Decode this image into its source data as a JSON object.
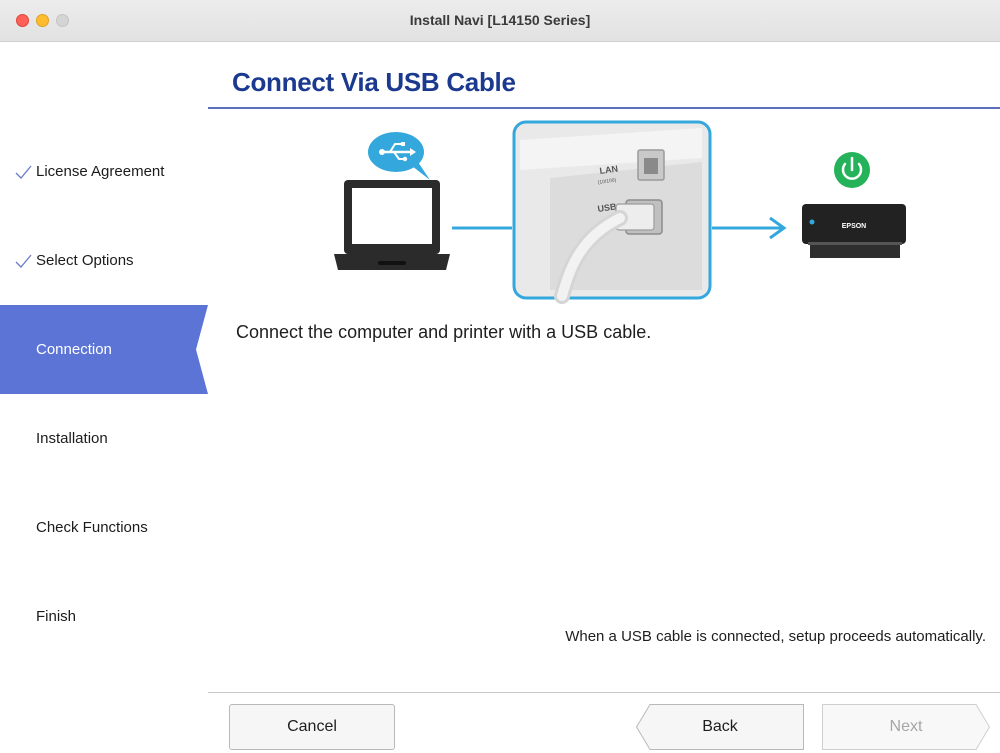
{
  "window": {
    "title": "Install Navi [L14150 Series]"
  },
  "sidebar": {
    "steps": [
      {
        "label": "License Agreement",
        "state": "done"
      },
      {
        "label": "Select Options",
        "state": "done"
      },
      {
        "label": "Connection",
        "state": "current"
      },
      {
        "label": "Installation",
        "state": "pending"
      },
      {
        "label": "Check Functions",
        "state": "pending"
      },
      {
        "label": "Finish",
        "state": "pending"
      }
    ]
  },
  "main": {
    "heading": "Connect Via USB Cable",
    "illustration": {
      "port_label_lan": "LAN",
      "port_label_lan_sub": "(10/100)",
      "port_label_usb": "USB",
      "printer_brand": "EPSON",
      "icons": [
        "laptop-icon",
        "usb-symbol-icon",
        "printer-icon",
        "power-icon"
      ]
    },
    "instruction": "Connect the computer and printer with a USB cable.",
    "footnote": "When a USB cable is connected, setup proceeds automatically."
  },
  "buttons": {
    "cancel": "Cancel",
    "back": "Back",
    "next": "Next"
  },
  "colors": {
    "accent": "#5b74d6",
    "heading": "#1b3a8f",
    "illustration_blue": "#34a8dc",
    "power_green": "#24b25a"
  }
}
